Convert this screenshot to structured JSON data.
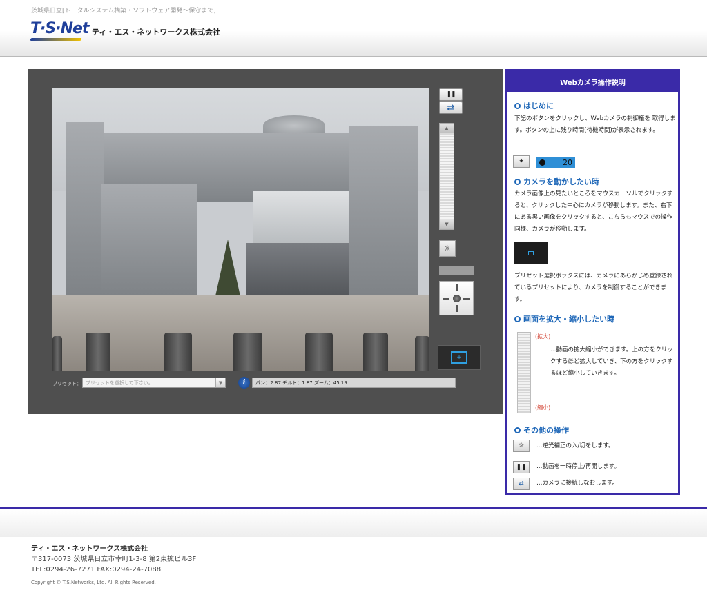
{
  "header": {
    "tagline": "茨城県日立[トータルシステム構築・ソフトウェア開発～保守まで]",
    "logo_text": "T·S·Net",
    "company_name": "ティ・エス・ネットワークス株式会社"
  },
  "camera": {
    "preset_label": "プリセット：",
    "preset_placeholder": "プリセットを選択して下さい。",
    "ptz_readout": "パン：2.87 チルト：1.87 ズーム：45.19"
  },
  "help": {
    "title": "Webカメラ操作説明",
    "s1_heading": "はじめに",
    "s1_text": "下記のボタンをクリックし、Webカメラの制御権を 取得します。ボタンの上に残り時間(待機時間)が表示されます。",
    "timer_value": "20",
    "s2_heading": "カメラを動かしたい時",
    "s2_text": "カメラ画像上の見たいところをマウスカーソルでクリックすると、クリックした中心にカメラが移動します。また、右下にある黒い画像をクリックすると、こちらもマウスでの操作同様、カメラが移動します。",
    "s2_text2": "プリセット選択ボックスには、カメラにあらかじめ登録されているプリセットにより、カメラを制御することができます。",
    "s3_heading": "画面を拡大・縮小したい時",
    "zoom_in_note": "(拡大)",
    "zoom_out_note": "(縮小)",
    "s3_text": "…動画の拡大縮小ができます。上の方をクリックするほど拡大していき、下の方をクリックするほど縮小していきます。",
    "s4_heading": "その他の操作",
    "op1": "…逆光補正の入/切をします。",
    "op2": "…動画を一時停止/再開します。",
    "op3": "…カメラに接続しなおします。"
  },
  "footer": {
    "company": "ティ・エス・ネットワークス株式会社",
    "address": "〒317-0073 茨城県日立市幸町1-3-8 第2東拡ビル3F",
    "phone": "TEL:0294-26-7271  FAX:0294-24-7088",
    "copyright": "Copyright © T.S.Networks, Ltd. All Rights Reserved."
  },
  "colors": {
    "accent": "#3a2aa8",
    "heading_blue": "#1e67b8",
    "panel_gray": "#4f4f4f"
  }
}
